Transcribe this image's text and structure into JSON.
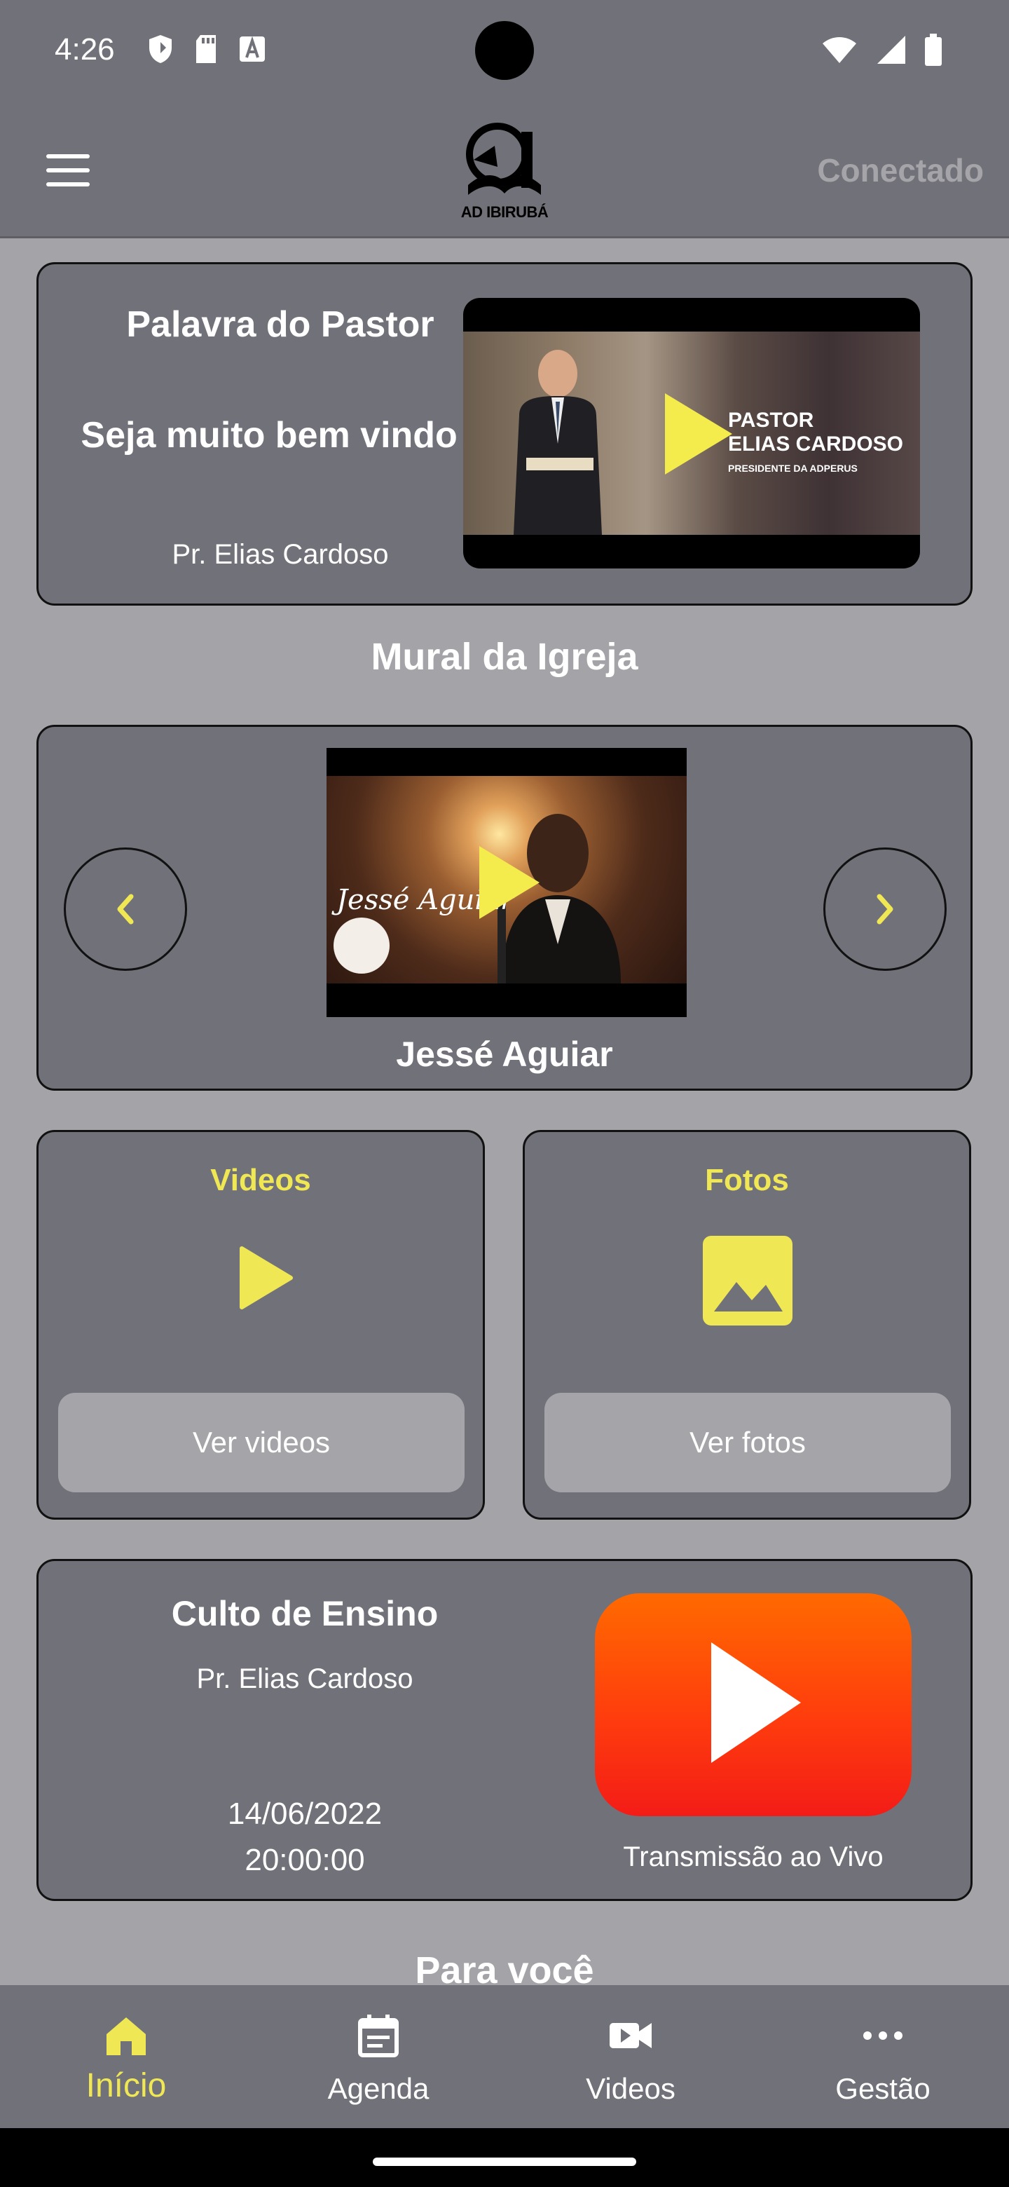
{
  "status_bar": {
    "time": "4:26"
  },
  "app_bar": {
    "logo_text": "AD IBIRUBÁ",
    "status": "Conectado"
  },
  "pastor_card": {
    "title": "Palavra do Pastor",
    "welcome": "Seja muito bem vindo !",
    "pastor_name": "Pr. Elias Cardoso",
    "video_caption_1": "PASTOR",
    "video_caption_2": "ELIAS CARDOSO",
    "video_caption_3": "PRESIDENTE DA ADPERUS"
  },
  "mural": {
    "section_title": "Mural da Igreja",
    "video_overlay_text": "Jessé Aguiar",
    "caption": "Jessé Aguiar"
  },
  "videos_card": {
    "title": "Videos",
    "button": "Ver videos"
  },
  "photos_card": {
    "title": "Fotos",
    "button": "Ver fotos"
  },
  "culto_card": {
    "title": "Culto de Ensino",
    "pastor": "Pr. Elias Cardoso",
    "date": "14/06/2022",
    "time": "20:00:00",
    "live_label": "Transmissão ao Vivo"
  },
  "para_voce": "Para você",
  "bottom_nav": {
    "items": [
      {
        "label": "Início",
        "icon": "home-icon",
        "active": true
      },
      {
        "label": "Agenda",
        "icon": "calendar-icon",
        "active": false
      },
      {
        "label": "Videos",
        "icon": "video-camera-icon",
        "active": false
      },
      {
        "label": "Gestão",
        "icon": "more-icon",
        "active": false
      }
    ]
  },
  "colors": {
    "background": "#a4a4a8",
    "card": "#717179",
    "accent_yellow": "#efe754",
    "youtube_red": "#ff3d0d"
  }
}
